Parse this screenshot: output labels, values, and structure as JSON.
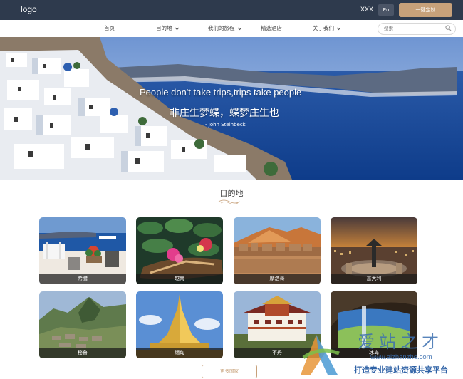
{
  "header": {
    "logo": "logo",
    "user": "XXX",
    "lang": "En",
    "custom_button": "一键定制"
  },
  "nav": {
    "items": [
      {
        "label": "首页",
        "dropdown": false
      },
      {
        "label": "目的地",
        "dropdown": true
      },
      {
        "label": "我们的旅程",
        "dropdown": true
      },
      {
        "label": "精选酒店",
        "dropdown": false
      },
      {
        "label": "关于我们",
        "dropdown": true
      }
    ],
    "search_placeholder": "搜索"
  },
  "hero": {
    "quote_en": "People don't take trips,trips take people",
    "quote_cn": "非庄生梦蝶，蝶梦庄生也",
    "author": "- John Steinbeck"
  },
  "destinations": {
    "title": "目的地",
    "cards": [
      {
        "name": "希腊",
        "scene": "greece-balcony"
      },
      {
        "name": "越南",
        "scene": "vietnam-lotus"
      },
      {
        "name": "摩洛哥",
        "scene": "morocco-desert"
      },
      {
        "name": "意大利",
        "scene": "italy-vatican"
      },
      {
        "name": "秘鲁",
        "scene": "peru-machu-picchu"
      },
      {
        "name": "缅甸",
        "scene": "myanmar-pagoda"
      },
      {
        "name": "不丹",
        "scene": "bhutan-dzong"
      },
      {
        "name": "冰岛",
        "scene": "iceland-waterfall"
      }
    ],
    "more_button": "更多国家"
  },
  "watermark": {
    "cn": "爱站之才",
    "url": "www.aizhanzhe.com",
    "slogan": "打造专业建站资源共享平台"
  },
  "colors": {
    "topbar": "#2e3a4d",
    "accent": "#c7a17a",
    "sea": "#1e4fa0"
  }
}
